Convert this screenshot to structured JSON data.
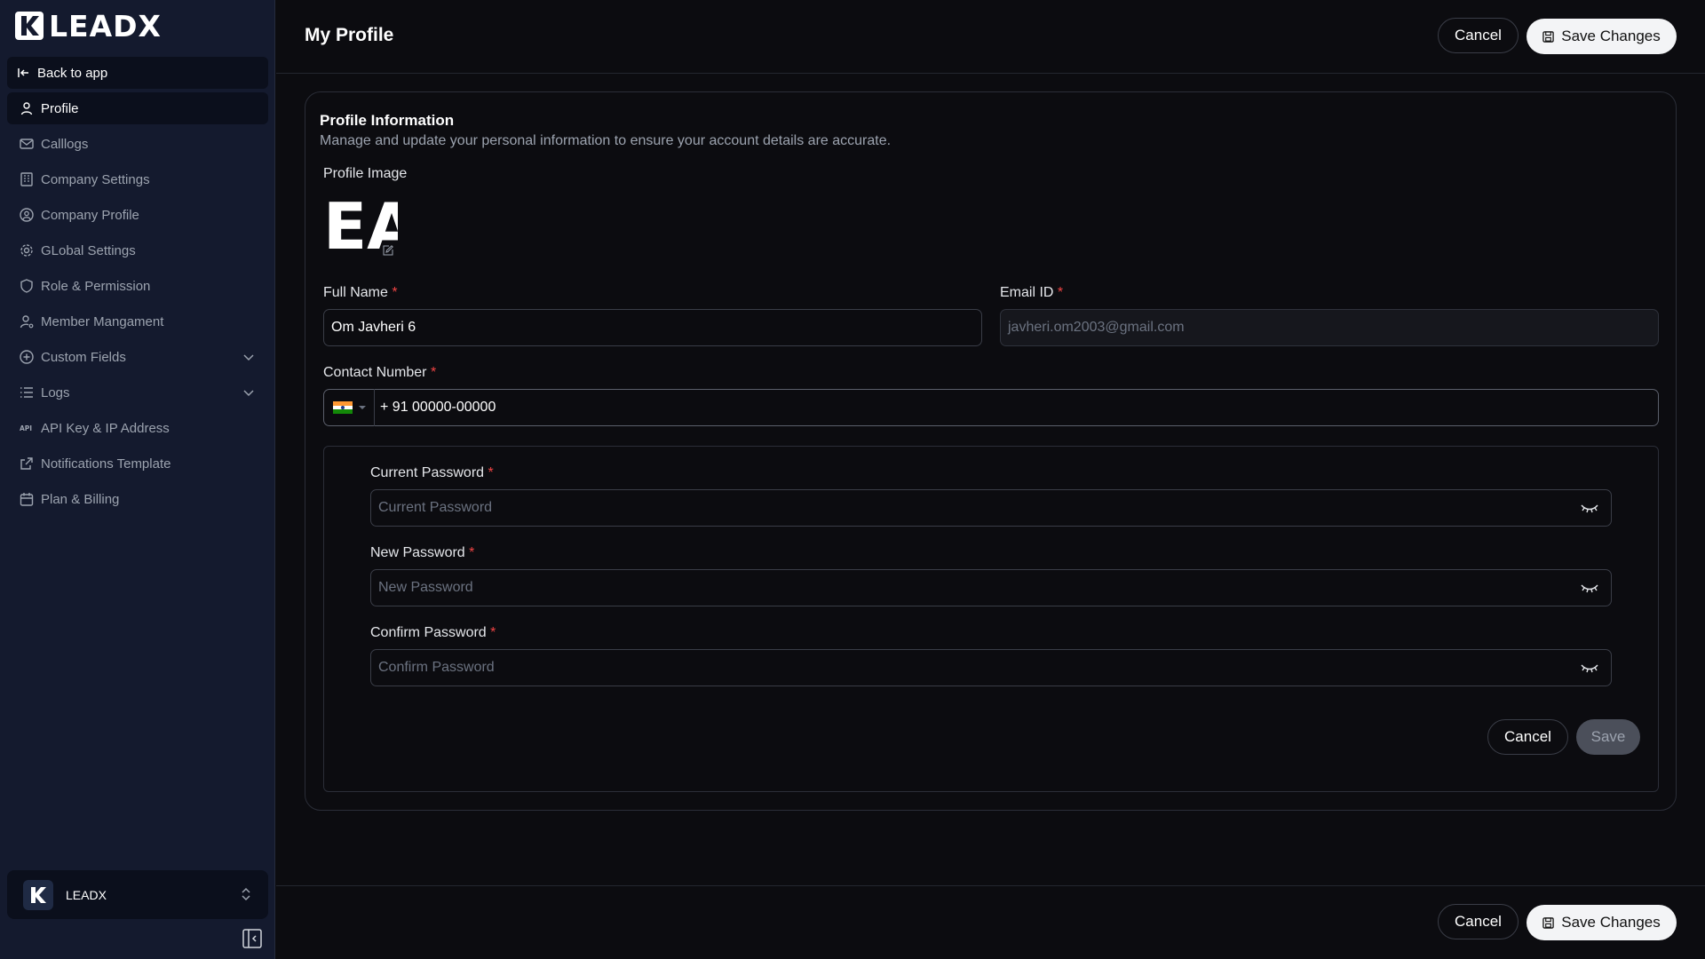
{
  "brand": {
    "name": "LEADX"
  },
  "sidebar": {
    "back_label": "Back to app",
    "items": [
      {
        "label": "Profile",
        "icon": "user-icon",
        "active": true
      },
      {
        "label": "Calllogs",
        "icon": "mail-icon"
      },
      {
        "label": "Company Settings",
        "icon": "building-icon"
      },
      {
        "label": "Company Profile",
        "icon": "user-circle-icon"
      },
      {
        "label": "GLobal Settings",
        "icon": "gear-icon"
      },
      {
        "label": "Role & Permission",
        "icon": "shield-icon"
      },
      {
        "label": "Member Mangament",
        "icon": "user-gear-icon"
      },
      {
        "label": "Custom Fields",
        "icon": "plus-circle-icon",
        "expandable": true
      },
      {
        "label": "Logs",
        "icon": "list-icon",
        "expandable": true
      },
      {
        "label": "API Key & IP Address",
        "icon": "api-icon"
      },
      {
        "label": "Notifications Template",
        "icon": "external-link-icon"
      },
      {
        "label": "Plan & Billing",
        "icon": "calendar-icon"
      }
    ],
    "org": {
      "name": "LEADX"
    }
  },
  "header": {
    "title": "My Profile",
    "cancel_label": "Cancel",
    "save_label": "Save Changes"
  },
  "profile": {
    "section_title": "Profile Information",
    "section_desc": "Manage and update your personal information to ensure your account details are accurate.",
    "image_label": "Profile Image",
    "avatar_initials": "EA",
    "full_name_label": "Full Name",
    "full_name_value": "Om Javheri 6",
    "email_label": "Email ID",
    "email_value": "javheri.om2003@gmail.com",
    "contact_label": "Contact Number",
    "contact_value": "+ 91 00000-00000",
    "required_mark": "*"
  },
  "password": {
    "current_label": "Current Password",
    "current_placeholder": "Current Password",
    "new_label": "New Password",
    "new_placeholder": "New Password",
    "confirm_label": "Confirm Password",
    "confirm_placeholder": "Confirm Password",
    "cancel_label": "Cancel",
    "save_label": "Save"
  },
  "footer": {
    "cancel_label": "Cancel",
    "save_label": "Save Changes"
  }
}
